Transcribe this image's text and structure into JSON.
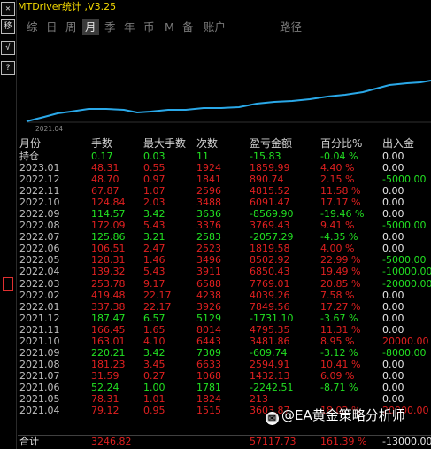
{
  "app": {
    "title": "MTDriver统计 ,V3.25"
  },
  "left_strip": {
    "buttons": [
      "✕",
      "移",
      "√",
      "?"
    ]
  },
  "tabs": [
    "综",
    "日",
    "周",
    "月",
    "季",
    "年",
    "币",
    "M",
    "备",
    "账户",
    "路径"
  ],
  "active_tab": "月",
  "chart": {
    "x_label": "2021.04",
    "line_color": "#2aa8e8"
  },
  "table": {
    "headers": [
      "月份",
      "手数",
      "最大手数",
      "次数",
      "盈亏金额",
      "百分比%",
      "出入金"
    ],
    "holding": {
      "label": "持仓",
      "lots": "0.17",
      "max_lots": "0.03",
      "count": "11",
      "pnl": "-15.83",
      "pct": "-0.04 %",
      "flow": "0.00"
    },
    "rows": [
      {
        "month": "2023.01",
        "lots": "48.31",
        "max_lots": "0.55",
        "count": "1924",
        "pnl": "1859.99",
        "pct": "4.40 %",
        "flow": "0.00",
        "color": "r"
      },
      {
        "month": "2022.12",
        "lots": "48.70",
        "max_lots": "0.97",
        "count": "1841",
        "pnl": "890.74",
        "pct": "2.15 %",
        "flow": "-5000.00",
        "color": "r"
      },
      {
        "month": "2022.11",
        "lots": "67.87",
        "max_lots": "1.07",
        "count": "2596",
        "pnl": "4815.52",
        "pct": "11.58 %",
        "flow": "0.00",
        "color": "r"
      },
      {
        "month": "2022.10",
        "lots": "124.84",
        "max_lots": "2.03",
        "count": "3488",
        "pnl": "6091.47",
        "pct": "17.17 %",
        "flow": "0.00",
        "color": "r"
      },
      {
        "month": "2022.09",
        "lots": "114.57",
        "max_lots": "3.42",
        "count": "3636",
        "pnl": "-8569.90",
        "pct": "-19.46 %",
        "flow": "0.00",
        "color": "g"
      },
      {
        "month": "2022.08",
        "lots": "172.09",
        "max_lots": "5.43",
        "count": "3376",
        "pnl": "3769.43",
        "pct": "9.41 %",
        "flow": "-5000.00",
        "color": "r"
      },
      {
        "month": "2022.07",
        "lots": "125.86",
        "max_lots": "3.21",
        "count": "2583",
        "pnl": "-2057.29",
        "pct": "-4.35 %",
        "flow": "0.00",
        "color": "g"
      },
      {
        "month": "2022.06",
        "lots": "106.51",
        "max_lots": "2.47",
        "count": "2523",
        "pnl": "1819.58",
        "pct": "4.00 %",
        "flow": "0.00",
        "color": "r"
      },
      {
        "month": "2022.05",
        "lots": "128.31",
        "max_lots": "1.46",
        "count": "3496",
        "pnl": "8502.92",
        "pct": "22.99 %",
        "flow": "-5000.00",
        "color": "r"
      },
      {
        "month": "2022.04",
        "lots": "139.32",
        "max_lots": "5.43",
        "count": "3911",
        "pnl": "6850.43",
        "pct": "19.49 %",
        "flow": "-10000.00",
        "color": "r"
      },
      {
        "month": "2022.03",
        "lots": "253.78",
        "max_lots": "9.17",
        "count": "6588",
        "pnl": "7769.01",
        "pct": "20.85 %",
        "flow": "-20000.00",
        "color": "r"
      },
      {
        "month": "2022.02",
        "lots": "419.48",
        "max_lots": "22.17",
        "count": "4238",
        "pnl": "4039.26",
        "pct": "7.58 %",
        "flow": "0.00",
        "color": "r"
      },
      {
        "month": "2022.01",
        "lots": "337.38",
        "max_lots": "22.17",
        "count": "3926",
        "pnl": "7849.56",
        "pct": "17.27 %",
        "flow": "0.00",
        "color": "r"
      },
      {
        "month": "2021.12",
        "lots": "187.47",
        "max_lots": "6.57",
        "count": "5129",
        "pnl": "-1731.10",
        "pct": "-3.67 %",
        "flow": "0.00",
        "color": "g"
      },
      {
        "month": "2021.11",
        "lots": "166.45",
        "max_lots": "1.65",
        "count": "8014",
        "pnl": "4795.35",
        "pct": "11.31 %",
        "flow": "0.00",
        "color": "r"
      },
      {
        "month": "2021.10",
        "lots": "163.01",
        "max_lots": "4.10",
        "count": "6443",
        "pnl": "3481.86",
        "pct": "8.95 %",
        "flow": "20000.00",
        "color": "r"
      },
      {
        "month": "2021.09",
        "lots": "220.21",
        "max_lots": "3.42",
        "count": "7309",
        "pnl": "-609.74",
        "pct": "-3.12 %",
        "flow": "-8000.00",
        "color": "g"
      },
      {
        "month": "2021.08",
        "lots": "181.23",
        "max_lots": "3.45",
        "count": "6633",
        "pnl": "2594.91",
        "pct": "10.41 %",
        "flow": "0.00",
        "color": "r"
      },
      {
        "month": "2021.07",
        "lots": "31.59",
        "max_lots": "0.27",
        "count": "1068",
        "pnl": "1432.13",
        "pct": "6.09 %",
        "flow": "0.00",
        "color": "r"
      },
      {
        "month": "2021.06",
        "lots": "52.24",
        "max_lots": "1.00",
        "count": "1781",
        "pnl": "-2242.51",
        "pct": "-8.71 %",
        "flow": "0.00",
        "color": "g"
      },
      {
        "month": "2021.05",
        "lots": "78.31",
        "max_lots": "1.01",
        "count": "1824",
        "pnl": "213",
        "pct": "",
        "flow": "0.00",
        "color": "r"
      },
      {
        "month": "2021.04",
        "lots": "79.12",
        "max_lots": "0.95",
        "count": "1515",
        "pnl": "3603.87",
        "pct": "18.02 %",
        "flow": "20000.00",
        "color": "r"
      }
    ],
    "total": {
      "label": "合计",
      "lots": "3246.82",
      "max_lots": "",
      "count": "",
      "pnl": "57117.73",
      "pct": "161.39 %",
      "flow": "-13000.00"
    }
  },
  "watermark": {
    "icon": "weibo-icon",
    "text": "@EA黄金策略分析师"
  }
}
